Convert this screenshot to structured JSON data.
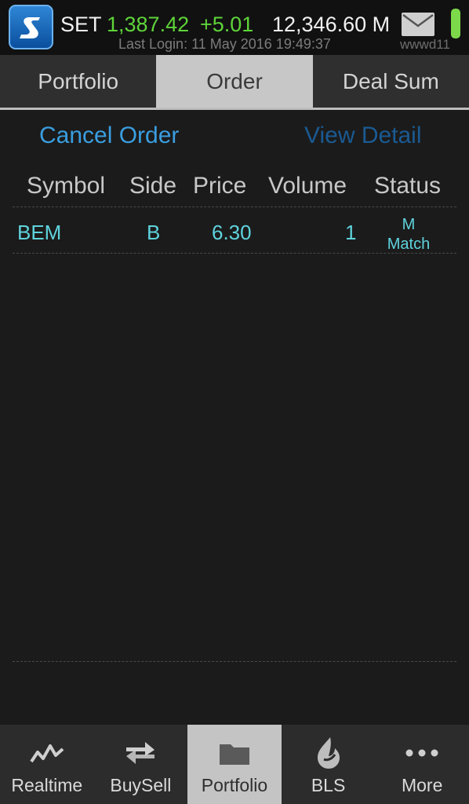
{
  "header": {
    "index_name": "SET",
    "index_value": "1,387.42",
    "index_change": "+5.01",
    "volume": "12,346.60 M",
    "last_login": "Last Login: 11 May 2016 19:49:37",
    "user_id": "wwwd11",
    "logo_icon": "app-logo-icon",
    "mail_icon": "mail-icon",
    "battery_icon": "battery-icon"
  },
  "tabs": [
    {
      "label": "Portfolio",
      "active": false
    },
    {
      "label": "Order",
      "active": true
    },
    {
      "label": "Deal Sum",
      "active": false
    }
  ],
  "actions": {
    "cancel_order": "Cancel Order",
    "view_detail": "View Detail"
  },
  "table": {
    "columns": [
      "Symbol",
      "Side",
      "Price",
      "Volume",
      "Status"
    ],
    "rows": [
      {
        "symbol": "BEM",
        "side": "B",
        "price": "6.30",
        "volume": "1",
        "status_line1": "M",
        "status_line2": "Match"
      }
    ]
  },
  "bottom_nav": [
    {
      "label": "Realtime",
      "icon": "pulse-chart-icon",
      "active": false
    },
    {
      "label": "BuySell",
      "icon": "swap-arrows-icon",
      "active": false
    },
    {
      "label": "Portfolio",
      "icon": "folder-icon",
      "active": true
    },
    {
      "label": "BLS",
      "icon": "bls-flame-logo-icon",
      "active": false
    },
    {
      "label": "More",
      "icon": "more-dots-icon",
      "active": false
    }
  ],
  "colors": {
    "index_up": "#5fd43a",
    "link_active": "#3a9ee0",
    "link_inactive": "#1a5a92",
    "row_text": "#5fd3dd",
    "tab_active_bg": "#c7c7c7"
  }
}
